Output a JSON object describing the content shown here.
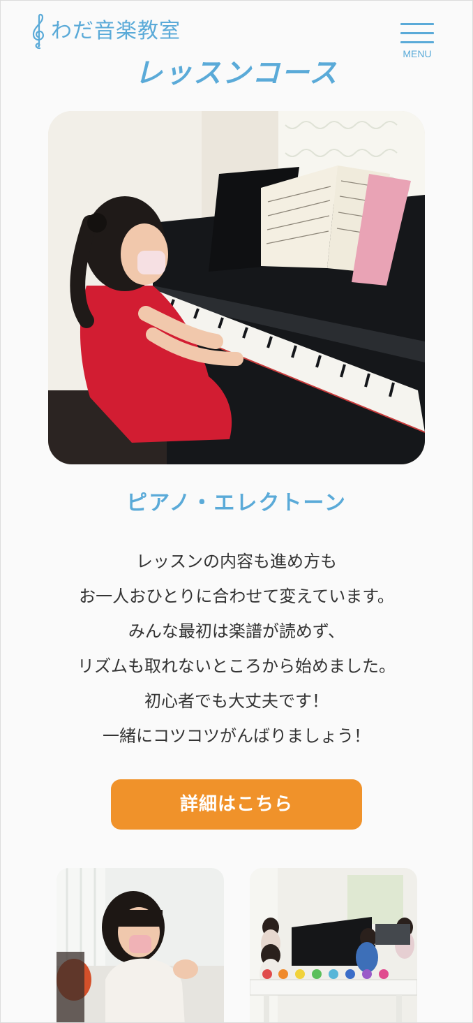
{
  "header": {
    "logo_text": "わだ音楽教室",
    "logo_icon": "treble-clef-icon",
    "menu_label": "MENU",
    "menu_icon": "hamburger-icon"
  },
  "section": {
    "title": "レッスンコース"
  },
  "course": {
    "image": "piano-lesson-photo",
    "title": "ピアノ・エレクトーン",
    "description": [
      "レッスンの内容も進め方も",
      "お一人おひとりに合わせて変えています。",
      "みんな最初は楽譜が読めず、",
      "リズムも取れないところから始めました。",
      "初心者でも大丈夫です！",
      "一緒にコツコツがんばりましょう！"
    ],
    "button_label": "詳細はこちら"
  },
  "thumbnails": [
    {
      "image": "child-rhythm-photo"
    },
    {
      "image": "group-handbell-photo"
    }
  ],
  "colors": {
    "accent": "#5aaad8",
    "button": "#f0922a",
    "text": "#333333",
    "background": "#fafafa"
  }
}
